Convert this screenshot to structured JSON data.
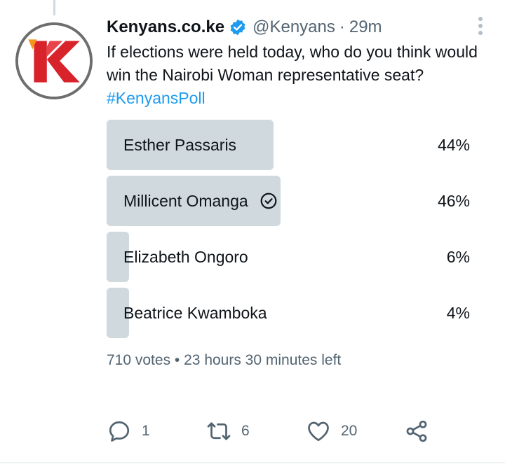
{
  "tweet": {
    "display_name": "Kenyans.co.ke",
    "handle": "@Kenyans",
    "separator": "·",
    "time": "29m",
    "text": "If elections were held today, who do you think would win the Nairobi Woman representative seat?",
    "hashtag": "#KenyansPoll",
    "avatar_icon": "kenyans-k-logo",
    "verified_icon": "verified-badge-icon",
    "colors": {
      "accent": "#1d9bf0",
      "bar": "#cfd9de",
      "muted": "#536471",
      "logo_red": "#d9232a",
      "logo_orange": "#f7941d"
    }
  },
  "poll": {
    "options": [
      {
        "label": "Esther Passaris",
        "percent": "44%",
        "share": 44,
        "selected": false
      },
      {
        "label": "Millicent Omanga",
        "percent": "46%",
        "share": 46,
        "selected": true
      },
      {
        "label": "Elizabeth Ongoro",
        "percent": "6%",
        "share": 6,
        "selected": false
      },
      {
        "label": "Beatrice Kwamboka",
        "percent": "4%",
        "share": 4,
        "selected": false
      }
    ],
    "votes": "710 votes",
    "bullet": "•",
    "time_left": "23 hours 30 minutes left"
  },
  "actions": {
    "reply": {
      "icon": "reply-icon",
      "count": "1"
    },
    "retweet": {
      "icon": "retweet-icon",
      "count": "6"
    },
    "like": {
      "icon": "heart-icon",
      "count": "20"
    },
    "share": {
      "icon": "share-icon"
    }
  }
}
